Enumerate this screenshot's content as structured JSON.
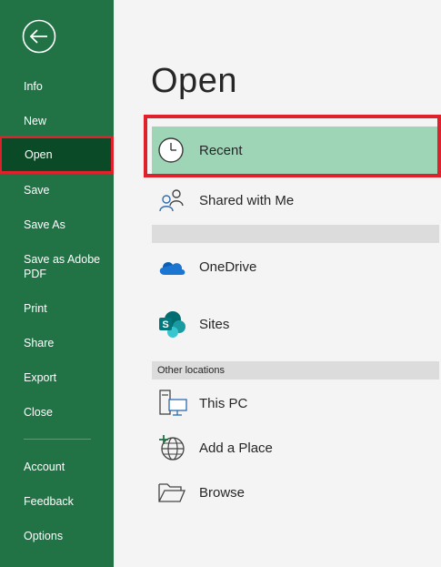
{
  "sidebar": {
    "items": [
      {
        "label": "Info"
      },
      {
        "label": "New"
      },
      {
        "label": "Open"
      },
      {
        "label": "Save"
      },
      {
        "label": "Save As"
      },
      {
        "label": "Save as Adobe PDF"
      },
      {
        "label": "Print"
      },
      {
        "label": "Share"
      },
      {
        "label": "Export"
      },
      {
        "label": "Close"
      },
      {
        "label": "Account"
      },
      {
        "label": "Feedback"
      },
      {
        "label": "Options"
      }
    ]
  },
  "main": {
    "title": "Open",
    "recent_label": "Recent",
    "shared_label": "Shared with Me",
    "onedrive_label": "OneDrive",
    "sites_label": "Sites",
    "other_locations_label": "Other locations",
    "thispc_label": "This PC",
    "addplace_label": "Add a Place",
    "browse_label": "Browse"
  },
  "colors": {
    "sidebar": "#217346",
    "selected": "#0b4a26",
    "highlight": "#e0202a",
    "recent_bg": "#9fd5b7"
  }
}
